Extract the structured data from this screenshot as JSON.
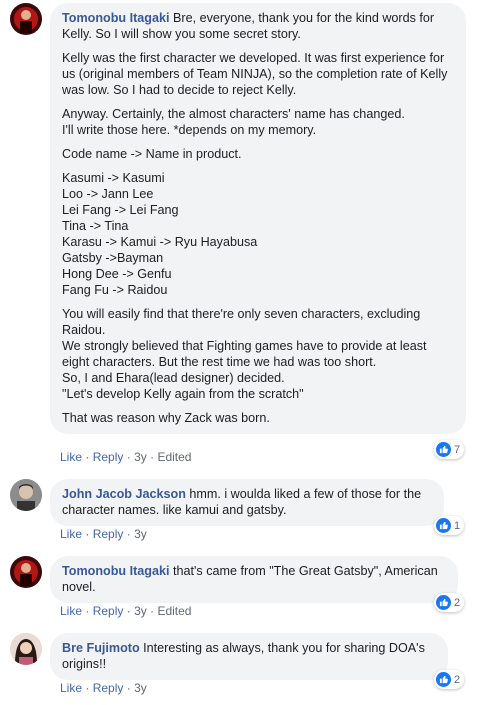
{
  "comments": [
    {
      "author": "Tomonobu Itagaki",
      "first_line": " Bre, everyone, thank you for the kind words for Kelly. So I will show you some secret story.",
      "paragraphs": [
        "Kelly was the first character we developed. It was first experience for us (original members of Team NINJA), so the completion rate of Kelly was low. So I had to decide to reject Kelly.",
        "Anyway. Certainly, the almost characters' name has changed.\nI'll write those here. *depends on my memory.",
        "Code name -> Name in product.",
        "Kasumi -> Kasumi\nLoo -> Jann Lee\nLei Fang -> Lei Fang\nTina -> Tina\nKarasu -> Kamui -> Ryu Hayabusa\nGatsby ->Bayman\nHong Dee -> Genfu\nFang Fu -> Raidou",
        "You will easily find that there're only seven characters, excluding Raidou.\nWe strongly believed that Fighting games have to provide at least eight characters. But the rest time we had was too short.\nSo, I and Ehara(lead designer) decided.\n\"Let's develop Kelly again from the scratch\"",
        "That was reason why Zack was born."
      ],
      "actions": {
        "like": "Like",
        "reply": "Reply",
        "time": "3y",
        "edited": "Edited"
      },
      "reaction_count": "7"
    },
    {
      "author": "John Jacob Jackson",
      "text": " hmm. i woulda liked a few of those for the character names. like kamui and gatsby.",
      "actions": {
        "like": "Like",
        "reply": "Reply",
        "time": "3y"
      },
      "reaction_count": "1"
    },
    {
      "author": "Tomonobu Itagaki",
      "text": " that's came from \"The Great Gatsby\", American novel.",
      "actions": {
        "like": "Like",
        "reply": "Reply",
        "time": "3y",
        "edited": "Edited"
      },
      "reaction_count": "2"
    },
    {
      "author": "Bre Fujimoto",
      "text": " Interesting as always, thank you for sharing DOA's origins!!",
      "actions": {
        "like": "Like",
        "reply": "Reply",
        "time": "3y"
      },
      "reaction_count": "2"
    }
  ],
  "colors": {
    "author": "#385898",
    "link": "#4267b2",
    "bubble": "#f2f3f5",
    "like_blue": "#1877f2"
  },
  "icons": {
    "reaction": "thumbs-up-icon"
  }
}
